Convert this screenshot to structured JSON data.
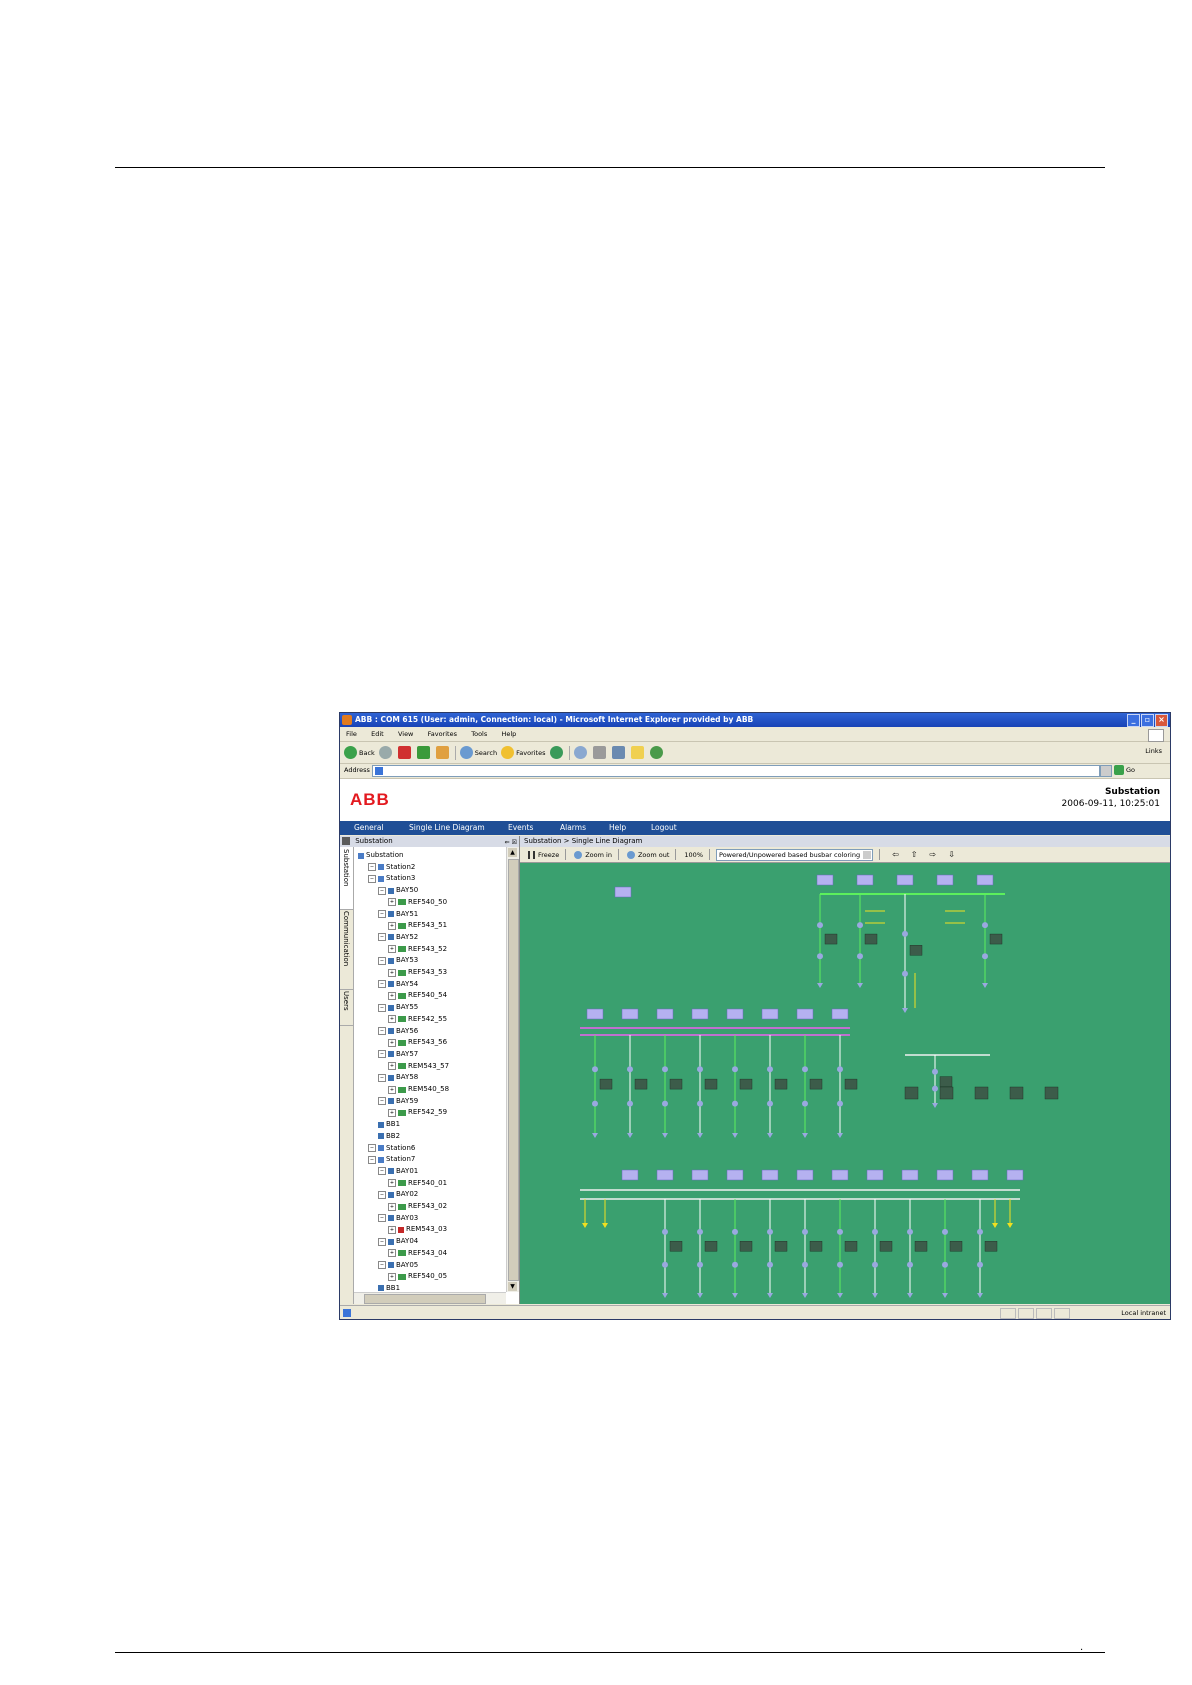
{
  "window": {
    "title": "ABB : COM 615 (User: admin, Connection: local) - Microsoft Internet Explorer provided by ABB"
  },
  "browser": {
    "menu": [
      "File",
      "Edit",
      "View",
      "Favorites",
      "Tools",
      "Help"
    ],
    "toolbar": {
      "back": "Back",
      "search": "Search",
      "favorites": "Favorites",
      "links": "Links"
    },
    "address_label": "Address",
    "go_label": "Go",
    "status_zone": "Local intranet"
  },
  "app": {
    "logo": "ABB",
    "title": "Substation",
    "datetime": "2006-09-11, 10:25:01",
    "nav": [
      "General",
      "Single Line Diagram",
      "Events",
      "Alarms",
      "Help",
      "Logout"
    ]
  },
  "left_panel": {
    "header": "Substation",
    "vtabs": [
      "Substation",
      "Communication",
      "Users"
    ],
    "tree": [
      {
        "label": "Substation",
        "depth": 0,
        "kind": "root"
      },
      {
        "label": "Station2",
        "depth": 1,
        "kind": "station"
      },
      {
        "label": "Station3",
        "depth": 1,
        "kind": "station"
      },
      {
        "label": "BAY50",
        "depth": 2,
        "kind": "bay"
      },
      {
        "label": "REF540_50",
        "depth": 3,
        "kind": "dev"
      },
      {
        "label": "BAY51",
        "depth": 2,
        "kind": "bay"
      },
      {
        "label": "REF543_51",
        "depth": 3,
        "kind": "dev"
      },
      {
        "label": "BAY52",
        "depth": 2,
        "kind": "bay"
      },
      {
        "label": "REF543_52",
        "depth": 3,
        "kind": "dev"
      },
      {
        "label": "BAY53",
        "depth": 2,
        "kind": "bay"
      },
      {
        "label": "REF543_53",
        "depth": 3,
        "kind": "dev"
      },
      {
        "label": "BAY54",
        "depth": 2,
        "kind": "bay"
      },
      {
        "label": "REF540_54",
        "depth": 3,
        "kind": "dev"
      },
      {
        "label": "BAY55",
        "depth": 2,
        "kind": "bay"
      },
      {
        "label": "REF542_55",
        "depth": 3,
        "kind": "dev"
      },
      {
        "label": "BAY56",
        "depth": 2,
        "kind": "bay"
      },
      {
        "label": "REF543_56",
        "depth": 3,
        "kind": "dev"
      },
      {
        "label": "BAY57",
        "depth": 2,
        "kind": "bay"
      },
      {
        "label": "REM543_57",
        "depth": 3,
        "kind": "dev"
      },
      {
        "label": "BAY58",
        "depth": 2,
        "kind": "bay"
      },
      {
        "label": "REM540_58",
        "depth": 3,
        "kind": "dev"
      },
      {
        "label": "BAY59",
        "depth": 2,
        "kind": "bay"
      },
      {
        "label": "REF542_59",
        "depth": 3,
        "kind": "dev"
      },
      {
        "label": "BB1",
        "depth": 2,
        "kind": "bay"
      },
      {
        "label": "BB2",
        "depth": 2,
        "kind": "bay"
      },
      {
        "label": "Station6",
        "depth": 1,
        "kind": "station"
      },
      {
        "label": "Station7",
        "depth": 1,
        "kind": "station"
      },
      {
        "label": "BAY01",
        "depth": 2,
        "kind": "bay"
      },
      {
        "label": "REF540_01",
        "depth": 3,
        "kind": "dev"
      },
      {
        "label": "BAY02",
        "depth": 2,
        "kind": "bay"
      },
      {
        "label": "REF543_02",
        "depth": 3,
        "kind": "dev"
      },
      {
        "label": "BAY03",
        "depth": 2,
        "kind": "bay"
      },
      {
        "label": "REM543_03",
        "depth": 3,
        "kind": "err"
      },
      {
        "label": "BAY04",
        "depth": 2,
        "kind": "bay"
      },
      {
        "label": "REF543_04",
        "depth": 3,
        "kind": "dev"
      },
      {
        "label": "BAY05",
        "depth": 2,
        "kind": "bay"
      },
      {
        "label": "REF540_05",
        "depth": 3,
        "kind": "dev"
      },
      {
        "label": "BB1",
        "depth": 2,
        "kind": "bay"
      }
    ]
  },
  "right_panel": {
    "breadcrumb": "Substation > Single Line Diagram",
    "tools": {
      "freeze": "Freeze",
      "zoom_in": "Zoom in",
      "zoom_out": "Zoom out",
      "zoom_level": "100%"
    },
    "coloring_select": "Powered/Unpowered based busbar coloring"
  },
  "colors": {
    "canvas": "#3aa06f",
    "nav": "#1f4e96",
    "logo": "#e3191f",
    "busbar_green": "#5cf05c",
    "busbar_magenta": "#c070d0",
    "busbar_white": "#f0f0f0",
    "block": "#b5b1f0",
    "load": "#f0e020"
  },
  "icons": {
    "back": "back-arrow-icon",
    "forward": "forward-arrow-icon",
    "stop": "stop-icon",
    "refresh": "refresh-icon",
    "home": "home-icon",
    "search": "search-icon",
    "favorites": "star-icon",
    "history": "history-icon",
    "mail": "mail-icon",
    "print": "print-icon"
  }
}
